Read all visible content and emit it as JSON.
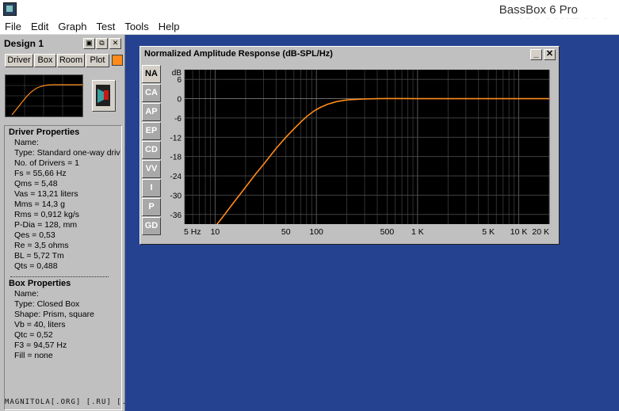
{
  "window": {
    "title": "BassBox 6 Pro",
    "brand": "MAGNITOLA"
  },
  "menu": [
    "File",
    "Edit",
    "Graph",
    "Test",
    "Tools",
    "Help"
  ],
  "design": {
    "title": "Design 1",
    "tabs": [
      "Driver",
      "Box",
      "Room",
      "Plot"
    ],
    "accent": "#ff8a1c"
  },
  "driver": {
    "heading": "Driver Properties",
    "rows": [
      "Name:",
      "Type: Standard one-way driv",
      "No. of Drivers = 1",
      "Fs =  55,66 Hz",
      "Qms =  5,48",
      "Vas = 13,21 liters",
      "Mms =  14,3 g",
      "Rms = 0,912 kg/s",
      "P-Dia = 128, mm",
      "Qes = 0,53",
      "Re =  3,5 ohms",
      "BL =  5,72 Tm",
      "Qts = 0,488"
    ]
  },
  "box": {
    "heading": "Box Properties",
    "rows": [
      "Name:",
      "Type: Closed Box",
      "Shape: Prism, square",
      "Vb = 40, liters",
      "Qtc = 0,52",
      "F3 = 94,57 Hz",
      "Fill = none"
    ]
  },
  "status": "MAGNITOLA[.ORG] [.RU] [.NET]",
  "graph": {
    "title": "Normalized Amplitude Response (dB-SPL/Hz)",
    "side_tabs": [
      "NA",
      "CA",
      "AP",
      "EP",
      "CD",
      "VV",
      "I",
      "P",
      "GD"
    ],
    "active_tab": "NA",
    "line_color": "#ff8c1a"
  },
  "chart_data": {
    "type": "line",
    "xscale": "log",
    "xlim": [
      5,
      20000
    ],
    "ylim": [
      -39,
      9
    ],
    "ylabel": "dB",
    "yticks": [
      6,
      0,
      -6,
      -12,
      -18,
      -24,
      -30,
      -36
    ],
    "xticks": [
      {
        "v": 5,
        "label": "5 Hz"
      },
      {
        "v": 10,
        "label": "10"
      },
      {
        "v": 50,
        "label": "50"
      },
      {
        "v": 100,
        "label": "100"
      },
      {
        "v": 500,
        "label": "500"
      },
      {
        "v": 1000,
        "label": "1 K"
      },
      {
        "v": 5000,
        "label": "5 K"
      },
      {
        "v": 10000,
        "label": "10 K"
      },
      {
        "v": 20000,
        "label": "20 K"
      }
    ],
    "x": [
      10,
      12,
      15,
      20,
      25,
      30,
      40,
      50,
      60,
      70,
      80,
      95,
      110,
      130,
      160,
      200,
      250,
      300,
      400,
      500,
      700,
      1000,
      2000,
      5000,
      10000,
      20000
    ],
    "y": [
      -39.8,
      -36.6,
      -32.6,
      -27.5,
      -23.5,
      -20.5,
      -15.5,
      -12.0,
      -9.4,
      -7.3,
      -5.6,
      -3.8,
      -2.7,
      -1.7,
      -0.9,
      -0.4,
      -0.2,
      -0.1,
      0.0,
      0.05,
      0.05,
      0.0,
      0.0,
      0.0,
      0.0,
      0.0
    ]
  }
}
